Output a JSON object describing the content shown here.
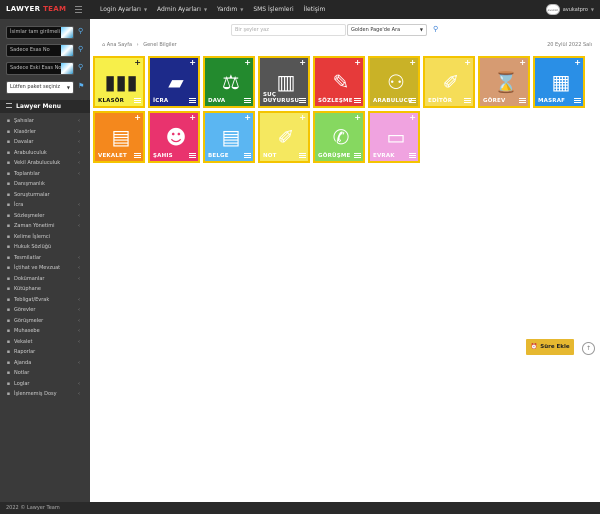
{
  "brand": {
    "main": "LAWYER",
    "accent": "TEAM"
  },
  "topnav": [
    {
      "label": "Login Ayarları",
      "caret": true
    },
    {
      "label": "Admin Ayarları",
      "caret": true
    },
    {
      "label": "Yardım",
      "caret": true
    },
    {
      "label": "SMS İşlemleri",
      "caret": false
    },
    {
      "label": "İletişim",
      "caret": false
    }
  ],
  "user": {
    "name": "avukatpro",
    "avatar_text": "avukat"
  },
  "sidebar": {
    "inputs": [
      {
        "placeholder": "İsimlar tam girilmeli"
      },
      {
        "placeholder": "Sadece Esas No"
      },
      {
        "placeholder": "Sadece Eski Esas No"
      }
    ],
    "package_select": "Lütfen paket seçiniz",
    "menu_title": "Lawyer Menu",
    "items": [
      {
        "label": "Şahıslar",
        "icon": "users-icon",
        "arrow": true
      },
      {
        "label": "Klasörler",
        "icon": "folder-icon",
        "arrow": true
      },
      {
        "label": "Davalar",
        "icon": "scale-icon",
        "arrow": true
      },
      {
        "label": "Arabuluculuk",
        "icon": "handshake-icon",
        "arrow": true
      },
      {
        "label": "Vekil Arabuluculuk",
        "icon": "handshake-icon",
        "arrow": true
      },
      {
        "label": "Toplantılar",
        "icon": "calendar-icon",
        "arrow": true
      },
      {
        "label": "Danışmanlık",
        "icon": "chat-icon",
        "arrow": false
      },
      {
        "label": "Soruşturmalar",
        "icon": "search-doc-icon",
        "arrow": false
      },
      {
        "label": "İcra",
        "icon": "gavel-icon",
        "arrow": true
      },
      {
        "label": "Sözleşmeler",
        "icon": "pen-icon",
        "arrow": true
      },
      {
        "label": "Zaman Yönetimi",
        "icon": "clock-icon",
        "arrow": true
      },
      {
        "label": "Kelime İşlemci",
        "icon": "edit-icon",
        "arrow": false
      },
      {
        "label": "Hukuk Sözlüğü",
        "icon": "book-icon",
        "arrow": false
      },
      {
        "label": "Tesmilatlar",
        "icon": "truck-icon",
        "arrow": true
      },
      {
        "label": "İçtihat ve Mevzuat",
        "icon": "library-icon",
        "arrow": true
      },
      {
        "label": "Dokümanlar",
        "icon": "doc-icon",
        "arrow": true
      },
      {
        "label": "Kütüphane",
        "icon": "bookshelf-icon",
        "arrow": false
      },
      {
        "label": "Tebligat/Evrak",
        "icon": "mail-icon",
        "arrow": true
      },
      {
        "label": "Görevler",
        "icon": "task-icon",
        "arrow": true
      },
      {
        "label": "Görüşmeler",
        "icon": "phone-icon",
        "arrow": true
      },
      {
        "label": "Muhasebe",
        "icon": "calculator-icon",
        "arrow": true
      },
      {
        "label": "Vekalet",
        "icon": "file-icon",
        "arrow": true
      },
      {
        "label": "Raporlar",
        "icon": "chart-icon",
        "arrow": false
      },
      {
        "label": "Ajanda",
        "icon": "agenda-icon",
        "arrow": true
      },
      {
        "label": "Notlar",
        "icon": "note-icon",
        "arrow": false
      },
      {
        "label": "Loglar",
        "icon": "log-icon",
        "arrow": true
      },
      {
        "label": "İşlenmemiş Dosy",
        "icon": "inbox-icon",
        "arrow": true
      }
    ]
  },
  "search": {
    "placeholder": "Bir şeyler yaz",
    "select_value": "Golden Page'de Ara"
  },
  "breadcrumb": {
    "home": "Ana Sayfa",
    "current": "Genel Bilgiler"
  },
  "date": "20 Eylül 2022 Salı",
  "tiles": [
    {
      "label": "KLASÖR",
      "color": "#f7ef4a",
      "icon": "binders-icon",
      "glyph": "▮▮▮",
      "dark": true
    },
    {
      "label": "İCRA",
      "color": "#1d2a8a",
      "icon": "folder-icon",
      "glyph": "▰",
      "dark": false
    },
    {
      "label": "DAVA",
      "color": "#238a2e",
      "icon": "scale-icon",
      "glyph": "⚖",
      "dark": false
    },
    {
      "label": "SUÇ DUYURUSU",
      "color": "#555555",
      "icon": "jail-icon",
      "glyph": "▥",
      "dark": false
    },
    {
      "label": "SÖZLEŞME",
      "color": "#e63a3a",
      "icon": "pen-icon",
      "glyph": "✎",
      "dark": false
    },
    {
      "label": "ARABULUCU",
      "color": "#c9b227",
      "icon": "meeting-icon",
      "glyph": "⚇",
      "dark": false
    },
    {
      "label": "EDİTÖR",
      "color": "#f5dd58",
      "icon": "edit-icon",
      "glyph": "✐",
      "dark": false
    },
    {
      "label": "GÖREV",
      "color": "#d69b72",
      "icon": "hourglass-icon",
      "glyph": "⌛",
      "dark": false
    },
    {
      "label": "MASRAF",
      "color": "#2a8fe6",
      "icon": "calculator-icon",
      "glyph": "▦",
      "dark": false
    },
    {
      "label": "VEKALET",
      "color": "#f4881d",
      "icon": "doc-icon",
      "glyph": "▤",
      "dark": false
    },
    {
      "label": "ŞAHIS",
      "color": "#e9336e",
      "icon": "users-icon",
      "glyph": "☻",
      "dark": false
    },
    {
      "label": "BELGE",
      "color": "#5bb6f2",
      "icon": "docs-icon",
      "glyph": "▤",
      "dark": false
    },
    {
      "label": "NOT",
      "color": "#f5e860",
      "icon": "note-icon",
      "glyph": "✐",
      "dark": false
    },
    {
      "label": "GÖRÜŞME",
      "color": "#86d860",
      "icon": "phone-icon",
      "glyph": "✆",
      "dark": false
    },
    {
      "label": "EVRAK",
      "color": "#f0a3e0",
      "icon": "papers-icon",
      "glyph": "▭",
      "dark": false
    }
  ],
  "add_button": "Süre Ekle",
  "footer": "2022 © Lawyer Team"
}
